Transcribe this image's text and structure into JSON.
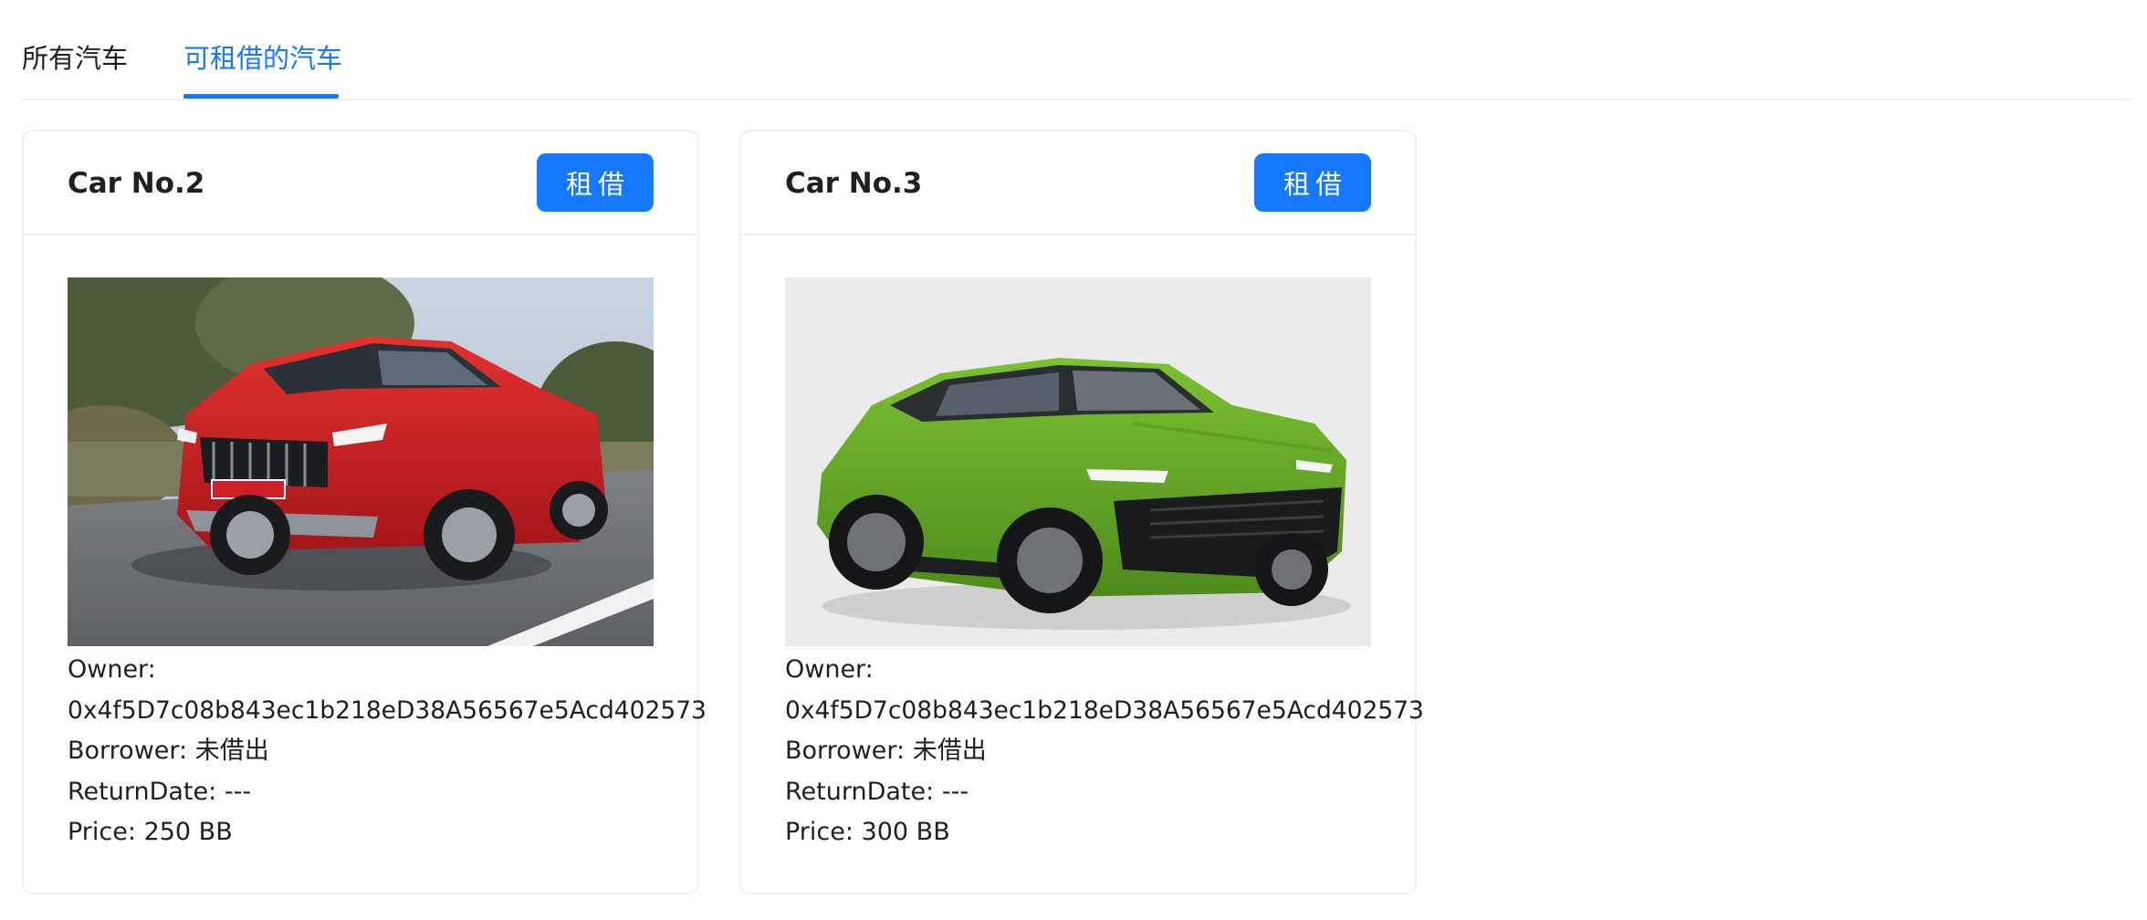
{
  "tabs": [
    {
      "label": "所有汽车",
      "active": false
    },
    {
      "label": "可租借的汽车",
      "active": true
    }
  ],
  "accent_color": "#1677ff",
  "cars": [
    {
      "title": "Car No.2",
      "button_label": "租借",
      "image": "red-suv-photo",
      "owner_label": "Owner:",
      "owner_address": "0x4f5D7c08b843ec1b218eD38A56567e5Acd402573",
      "borrower_label": "Borrower:",
      "borrower_value": "未借出",
      "return_label": "ReturnDate:",
      "return_value": "---",
      "price_label": "Price:",
      "price_value": "250 BB"
    },
    {
      "title": "Car No.3",
      "button_label": "租借",
      "image": "green-suv-photo",
      "owner_label": "Owner:",
      "owner_address": "0x4f5D7c08b843ec1b218eD38A56567e5Acd402573",
      "borrower_label": "Borrower:",
      "borrower_value": "未借出",
      "return_label": "ReturnDate:",
      "return_value": "---",
      "price_label": "Price:",
      "price_value": "300 BB"
    }
  ]
}
